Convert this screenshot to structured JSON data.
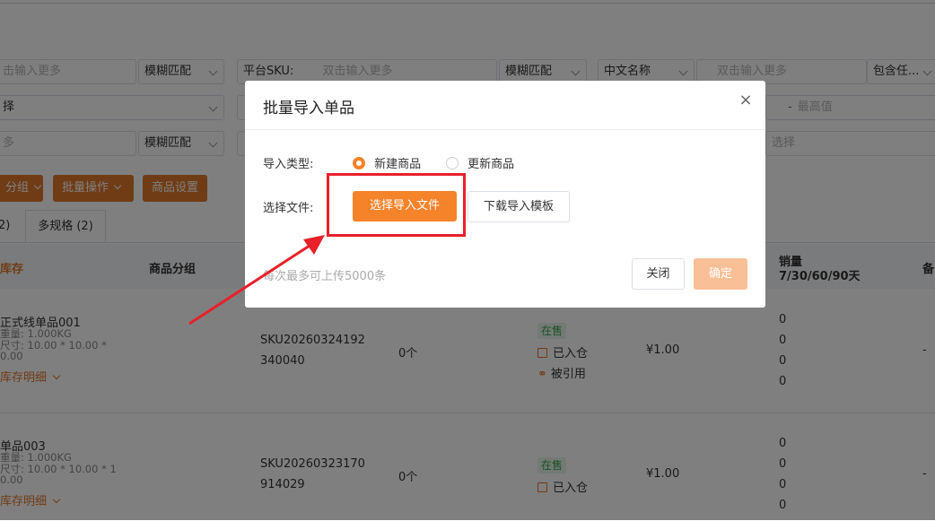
{
  "filters": {
    "row1": {
      "input1_placeholder": "击输入更多",
      "match1": "模糊匹配",
      "platform_sku_label": "平台SKU:",
      "input2_placeholder": "双击输入更多",
      "match2": "模糊匹配",
      "name_type": "中文名称",
      "input3_placeholder": "双击输入更多",
      "contains": "包含任..."
    },
    "row2": {
      "select1": "择",
      "max_placeholder": "最高值",
      "dash": "-"
    },
    "row3": {
      "input1_placeholder": "多",
      "match1": "模糊匹配",
      "select2": "选择"
    }
  },
  "toolbar": {
    "group_btn": "分组",
    "batch_btn": "批量操作",
    "settings_btn": "商品设置"
  },
  "tabs": {
    "single": "2)",
    "multi": "多规格 (2)"
  },
  "table": {
    "headers": {
      "stock": "库存",
      "group": "商品分组",
      "sales_line1": "销量",
      "sales_line2": "7/30/60/90天",
      "note": "备"
    },
    "rows": [
      {
        "name": "正式线单品001",
        "weight": "重量: 1.000KG",
        "size": "尺寸: 10.00 * 10.00 *",
        "size2": "0.00",
        "stock_detail": "库存明细",
        "sku_line1": "SKU20260324192",
        "sku_line2": "340040",
        "qty": "0个",
        "status": "在售",
        "warehouse": "已入仓",
        "ref": "被引用",
        "price": "¥1.00",
        "sales": [
          "0",
          "0",
          "0",
          "0"
        ],
        "note": "-"
      },
      {
        "name": "单品003",
        "weight": "重量: 1.000KG",
        "size": "尺寸: 10.00 * 10.00 * 1",
        "size2": "0.00",
        "stock_detail": "库存明细",
        "sku_line1": "SKU20260323170",
        "sku_line2": "914029",
        "qty": "0个",
        "status": "在售",
        "warehouse": "已入仓",
        "price": "¥1.00",
        "sales": [
          "0",
          "0",
          "0",
          "0"
        ],
        "note": "-"
      }
    ]
  },
  "modal": {
    "title": "批量导入单品",
    "close": "×",
    "import_type_label": "导入类型:",
    "option_new": "新建商品",
    "option_update": "更新商品",
    "select_file_label": "选择文件:",
    "select_file_btn": "选择导入文件",
    "download_template_btn": "下载导入模板",
    "hint": "每次最多可上传5000条",
    "close_btn": "关闭",
    "confirm_btn": "确定"
  },
  "colors": {
    "accent": "#f5832a",
    "highlight": "#e8202a",
    "status_green": "#35a04f"
  }
}
